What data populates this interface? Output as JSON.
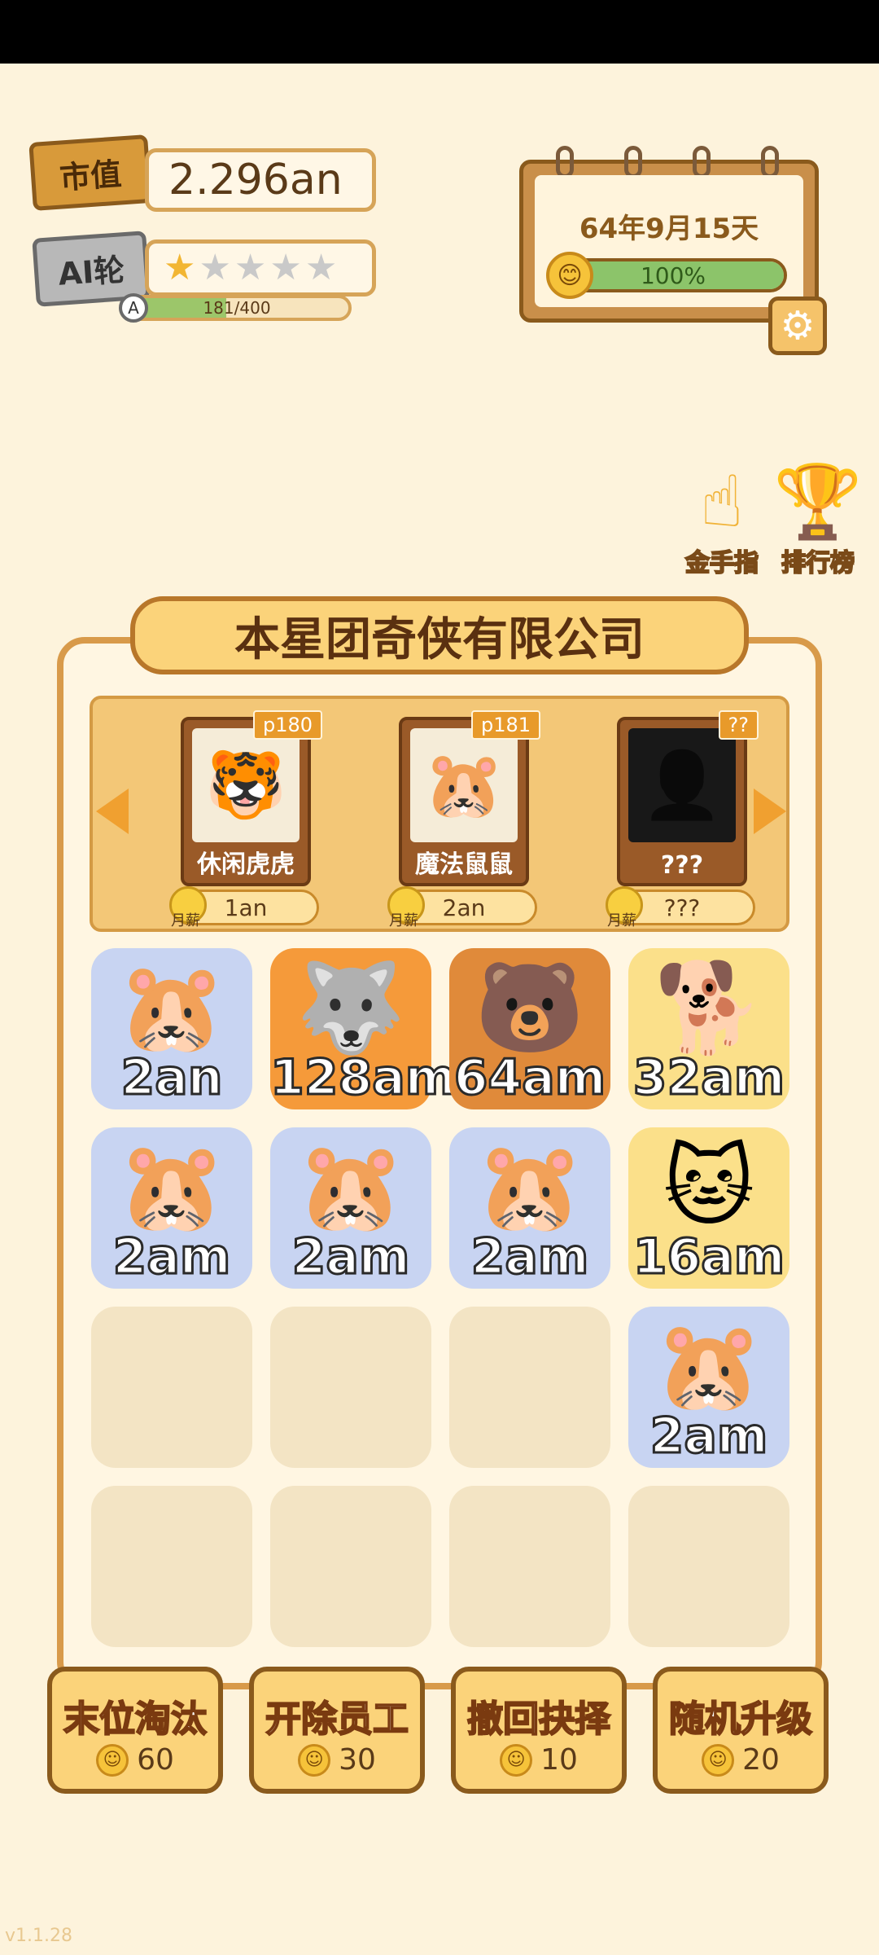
{
  "header": {
    "market_value_label": "市值",
    "market_value": "2.296an",
    "ai_label": "AI轮",
    "stars_filled": 1,
    "stars_total": 5,
    "xp_badge": "A",
    "xp_text": "181/400",
    "xp_fraction": 0.4525
  },
  "calendar": {
    "date": "64年9月15天",
    "mood_text": "100%",
    "mood_fraction": 1.0,
    "mood_icon": "😊"
  },
  "settings": {
    "icon": "⚙"
  },
  "side_buttons": [
    {
      "label": "金手指",
      "icon": "☝"
    },
    {
      "label": "排行榜",
      "icon": "🏆"
    }
  ],
  "company": {
    "title": "本星团奇侠有限公司",
    "cards": [
      {
        "tag": "p180",
        "name": "休闲虎虎",
        "salary_label": "月薪",
        "salary": "1an",
        "icon": "🐯"
      },
      {
        "tag": "p181",
        "name": "魔法鼠鼠",
        "salary_label": "月薪",
        "salary": "2an",
        "icon": "🐹"
      },
      {
        "tag": "??",
        "name": "???",
        "salary_label": "月薪",
        "salary": "???",
        "icon": "👤"
      }
    ]
  },
  "grid": [
    {
      "value": "2an",
      "pet": "🐹",
      "color": "blue"
    },
    {
      "value": "128am",
      "pet": "🐺",
      "color": "orange"
    },
    {
      "value": "64am",
      "pet": "🐻",
      "color": "brown"
    },
    {
      "value": "32am",
      "pet": "🐕",
      "color": "yellow"
    },
    {
      "value": "2am",
      "pet": "🐹",
      "color": "blue"
    },
    {
      "value": "2am",
      "pet": "🐹",
      "color": "blue"
    },
    {
      "value": "2am",
      "pet": "🐹",
      "color": "blue"
    },
    {
      "value": "16am",
      "pet": "🐱",
      "color": "yellow"
    },
    {
      "value": "",
      "pet": "",
      "color": "empty"
    },
    {
      "value": "",
      "pet": "",
      "color": "empty"
    },
    {
      "value": "",
      "pet": "",
      "color": "empty"
    },
    {
      "value": "2am",
      "pet": "🐹",
      "color": "blue"
    },
    {
      "value": "",
      "pet": "",
      "color": "empty"
    },
    {
      "value": "",
      "pet": "",
      "color": "empty"
    },
    {
      "value": "",
      "pet": "",
      "color": "empty"
    },
    {
      "value": "",
      "pet": "",
      "color": "empty"
    }
  ],
  "actions": [
    {
      "label": "末位淘汰",
      "cost": "60"
    },
    {
      "label": "开除员工",
      "cost": "30"
    },
    {
      "label": "撤回抉择",
      "cost": "10"
    },
    {
      "label": "随机升级",
      "cost": "20"
    }
  ],
  "version": "v1.1.28"
}
